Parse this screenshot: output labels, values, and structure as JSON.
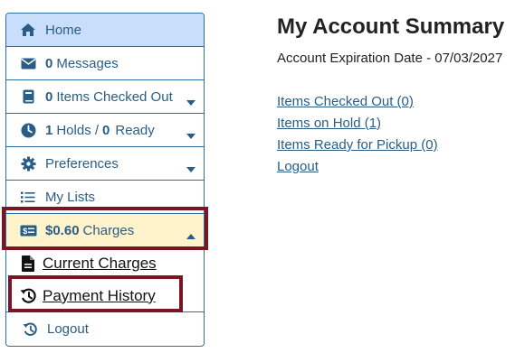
{
  "sidebar": {
    "home": {
      "label": "Home",
      "icon": "home-icon"
    },
    "messages": {
      "count": "0",
      "label": "Messages",
      "icon": "envelope-icon"
    },
    "checked_out": {
      "count": "0",
      "label": "Items Checked Out",
      "icon": "book-icon"
    },
    "holds": {
      "count": "1",
      "label": "Holds /",
      "ready_count": "0",
      "ready_label": "Ready",
      "icon": "clock-icon"
    },
    "preferences": {
      "label": "Preferences",
      "icon": "gear-icon"
    },
    "my_lists": {
      "label": "My Lists",
      "icon": "list-icon"
    },
    "charges": {
      "amount": "$0.60",
      "label": "Charges",
      "icon": "money-icon"
    },
    "current_charges": {
      "label": "Current Charges",
      "icon": "file-icon"
    },
    "payment_history": {
      "label": "Payment History",
      "icon": "history-icon"
    },
    "logout": {
      "label": "Logout",
      "icon": "history-icon"
    }
  },
  "main": {
    "title": "My Account Summary",
    "expiration_label": "Account Expiration Date - 07/03/2027",
    "links": [
      "Items Checked Out (0)",
      "Items on Hold (1)",
      "Items Ready for Pickup (0)",
      "Logout"
    ]
  },
  "colors": {
    "link": "#2a5d86",
    "active_bg": "#c9defa",
    "charges_bg": "#fff3cc",
    "highlight": "#7a1524",
    "border": "#2f6fa0"
  }
}
